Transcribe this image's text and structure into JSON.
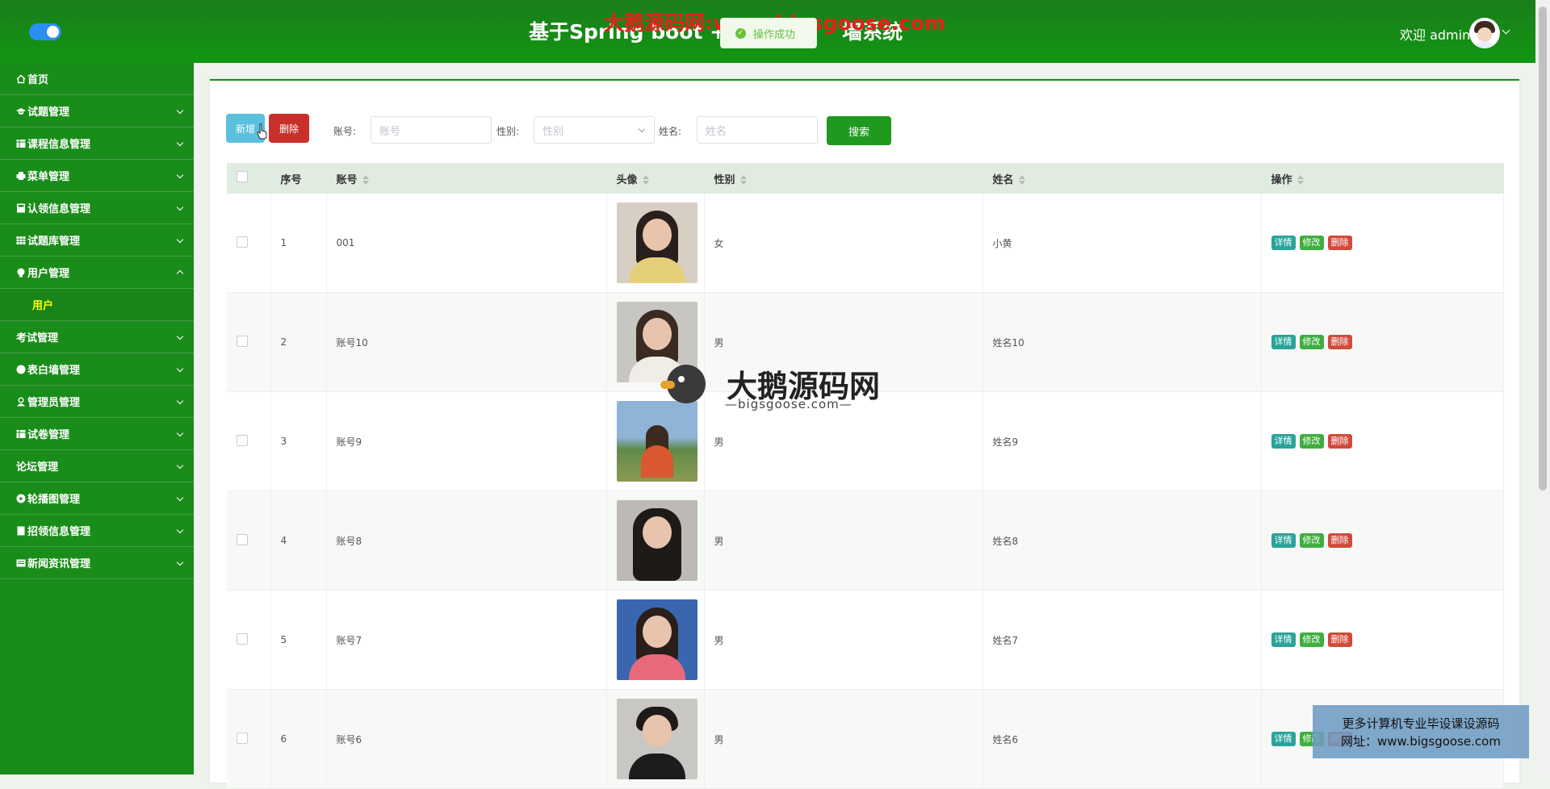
{
  "header": {
    "title": "基于Spring boot +Vue",
    "title_tail": "墙系统",
    "watermark": "大鹅源码网:www.bigsgoose.com",
    "toast": "操作成功",
    "welcome": "欢迎 admin"
  },
  "sidebar": {
    "items": [
      {
        "label": "首页",
        "icon": "home-icon",
        "expandable": false
      },
      {
        "label": "试题管理",
        "icon": "graduation-cap-icon",
        "expandable": true
      },
      {
        "label": "课程信息管理",
        "icon": "table-icon",
        "expandable": true
      },
      {
        "label": "菜单管理",
        "icon": "printer-icon",
        "expandable": true
      },
      {
        "label": "认领信息管理",
        "icon": "calculator-icon",
        "expandable": true
      },
      {
        "label": "试题库管理",
        "icon": "grid-icon",
        "expandable": true
      },
      {
        "label": "用户管理",
        "icon": "user-bulb-icon",
        "expandable": true,
        "expanded": true
      },
      {
        "label": "考试管理",
        "icon": "",
        "expandable": true
      },
      {
        "label": "表白墙管理",
        "icon": "circle-icon",
        "expandable": true
      },
      {
        "label": "管理员管理",
        "icon": "user-icon",
        "expandable": true
      },
      {
        "label": "试卷管理",
        "icon": "table-icon",
        "expandable": true
      },
      {
        "label": "论坛管理",
        "icon": "",
        "expandable": true
      },
      {
        "label": "轮播图管理",
        "icon": "play-circle-icon",
        "expandable": true
      },
      {
        "label": "招领信息管理",
        "icon": "book-icon",
        "expandable": true
      },
      {
        "label": "新闻资讯管理",
        "icon": "newspaper-icon",
        "expandable": true
      }
    ],
    "active_sub": "用户"
  },
  "toolbar": {
    "add_label": "新增",
    "delete_label": "删除",
    "account_label": "账号:",
    "account_placeholder": "账号",
    "gender_label": "性别:",
    "gender_placeholder": "性别",
    "name_label": "姓名:",
    "name_placeholder": "姓名",
    "search_label": "搜索"
  },
  "table": {
    "headers": [
      "序号",
      "账号",
      "头像",
      "性别",
      "姓名",
      "操作"
    ],
    "rows": [
      {
        "index": "1",
        "account": "001",
        "gender": "女",
        "name": "小黄"
      },
      {
        "index": "2",
        "account": "账号10",
        "gender": "男",
        "name": "姓名10"
      },
      {
        "index": "3",
        "account": "账号9",
        "gender": "男",
        "name": "姓名9"
      },
      {
        "index": "4",
        "account": "账号8",
        "gender": "男",
        "name": "姓名8"
      },
      {
        "index": "5",
        "account": "账号7",
        "gender": "男",
        "name": "姓名7"
      },
      {
        "index": "6",
        "account": "账号6",
        "gender": "男",
        "name": "姓名6"
      }
    ],
    "actions": {
      "detail": "详情",
      "edit": "修改",
      "remove": "删除"
    }
  },
  "watermarks": {
    "center_big": "大鹅源码网",
    "center_small": "—bigsgoose.com—",
    "box_line1": "更多计算机专业毕设课设源码",
    "box_line2": "网址：www.bigsgoose.com"
  },
  "colors": {
    "primary_green": "#1a8c1a",
    "active_sub": "#ffff00",
    "add_button": "#5bc0de",
    "delete_button": "#c9302c",
    "detail_action": "#2aa39a",
    "edit_action": "#3fae3f",
    "remove_action": "#d14b3c"
  }
}
